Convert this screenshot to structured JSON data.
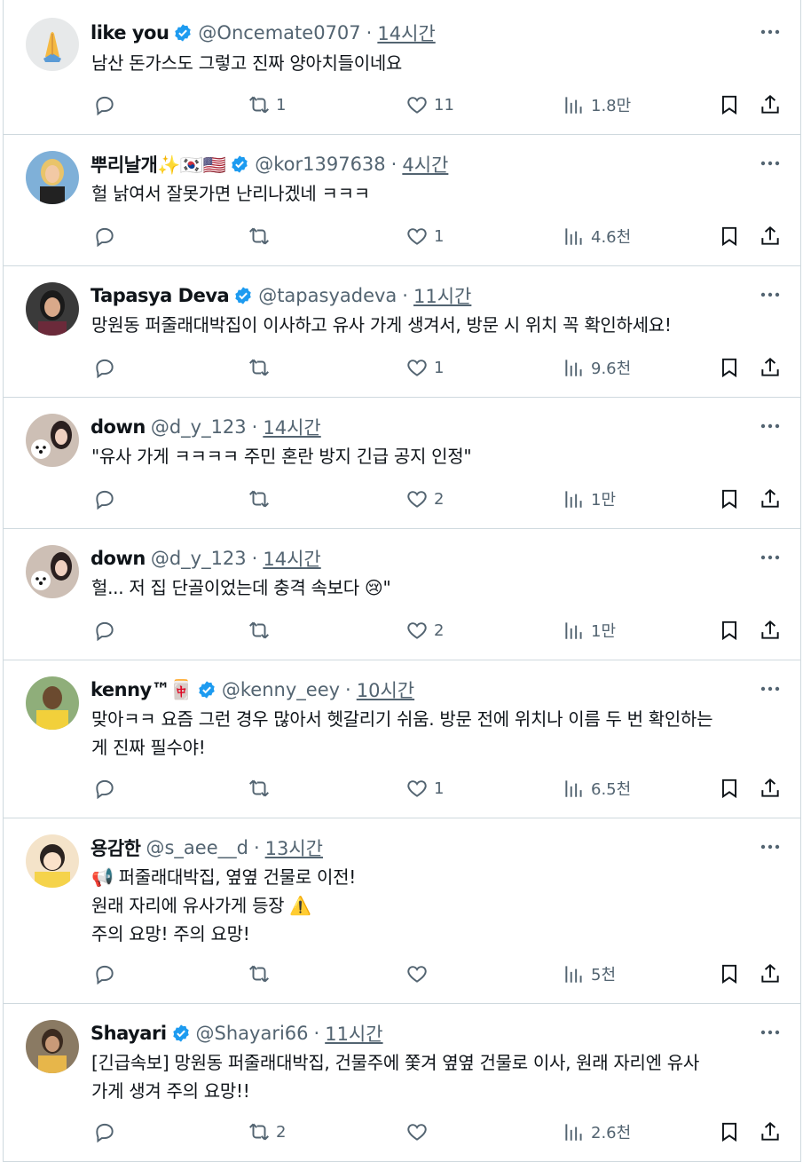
{
  "colors": {
    "text": "#0f1419",
    "muted": "#536471",
    "verified": "#1d9bf0",
    "border": "#cfd9de"
  },
  "tweets": [
    {
      "name": "like you",
      "handle": "@Oncemate0707",
      "time": "14시간",
      "verified": true,
      "avatar": "folded-hands",
      "lines": [
        "남산 돈가스도 그렇고 진짜 양아치들이네요"
      ],
      "counts": {
        "reply": "",
        "retweet": "1",
        "like": "11",
        "views": "1.8만"
      }
    },
    {
      "name": "뿌리날개✨🇰🇷🇺🇸",
      "handle": "@kor1397638",
      "time": "4시간",
      "verified": true,
      "avatar": "woman-blonde",
      "lines": [
        "헐 낡여서 잘못가면 난리나겠네 ㅋㅋㅋ"
      ],
      "counts": {
        "reply": "",
        "retweet": "",
        "like": "1",
        "views": "4.6천"
      }
    },
    {
      "name": "Tapasya Deva",
      "handle": "@tapasyadeva",
      "time": "11시간",
      "verified": true,
      "avatar": "woman-dark-hair",
      "lines": [
        "망원동 퍼줄래대박집이 이사하고 유사 가게 생겨서, 방문 시 위치 꼭 확인하세요!"
      ],
      "counts": {
        "reply": "",
        "retweet": "",
        "like": "1",
        "views": "9.6천"
      }
    },
    {
      "name": "down",
      "handle": "@d_y_123",
      "time": "14시간",
      "verified": false,
      "avatar": "people-with-dog",
      "lines": [
        "\"유사 가게 ㅋㅋㅋㅋ 주민 혼란 방지 긴급 공지 인정\""
      ],
      "counts": {
        "reply": "",
        "retweet": "",
        "like": "2",
        "views": "1만"
      }
    },
    {
      "name": "down",
      "handle": "@d_y_123",
      "time": "14시간",
      "verified": false,
      "avatar": "people-with-dog",
      "lines": [
        "헐... 저 집 단골이었는데 충격 속보다 😢\""
      ],
      "counts": {
        "reply": "",
        "retweet": "",
        "like": "2",
        "views": "1만"
      }
    },
    {
      "name": "kenny™🀄",
      "handle": "@kenny_eey",
      "time": "10시간",
      "verified": true,
      "avatar": "man-yellow",
      "lines": [
        "맞아ㅋㅋ 요즘 그런 경우 많아서 헷갈리기 쉬움. 방문 전에 위치나 이름 두 번 확인하는",
        "게 진짜 필수야!"
      ],
      "counts": {
        "reply": "",
        "retweet": "",
        "like": "1",
        "views": "6.5천"
      }
    },
    {
      "name": "용감한",
      "handle": "@s_aee__d",
      "time": "13시간",
      "verified": false,
      "avatar": "cartoon-person",
      "lines": [
        "📢 퍼줄래대박집, 옆옆 건물로 이전!",
        "원래 자리에 유사가게 등장 ⚠️",
        "주의 요망! 주의 요망!"
      ],
      "counts": {
        "reply": "",
        "retweet": "",
        "like": "",
        "views": "5천"
      }
    },
    {
      "name": "Shayari",
      "handle": "@Shayari66",
      "time": "11시간",
      "verified": true,
      "avatar": "woman-selfie",
      "lines": [
        "[긴급속보] 망원동 퍼줄래대박집, 건물주에 쫓겨 옆옆 건물로 이사, 원래 자리엔 유사",
        "가게 생겨 주의 요망!!"
      ],
      "counts": {
        "reply": "",
        "retweet": "2",
        "like": "",
        "views": "2.6천"
      }
    }
  ]
}
